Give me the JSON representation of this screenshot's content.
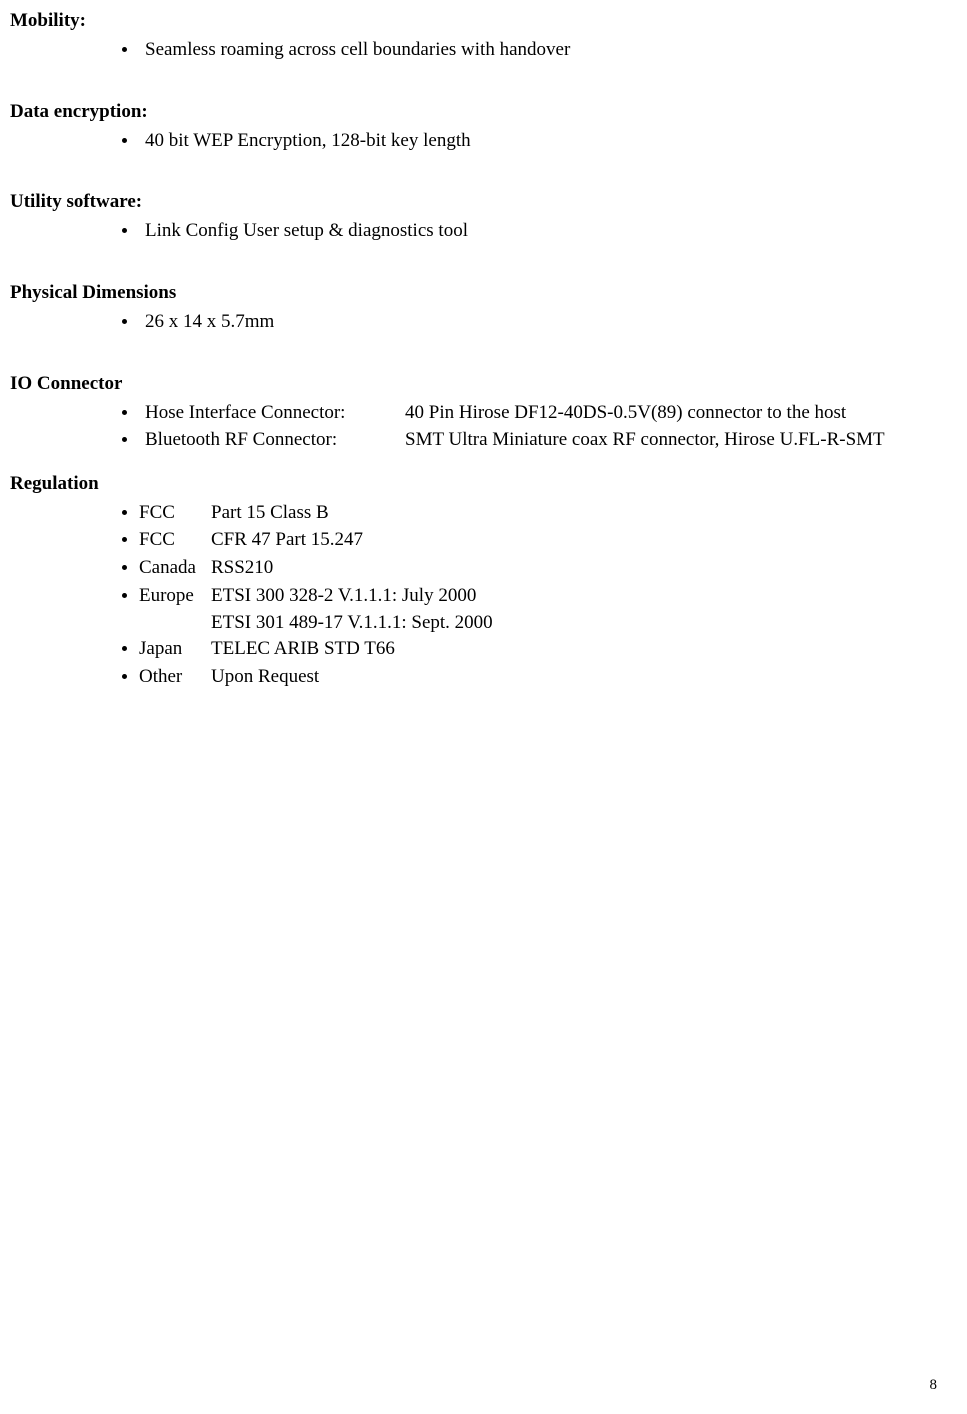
{
  "sections": {
    "mobility": {
      "header": "Mobility:",
      "item0": "Seamless roaming across cell boundaries with handover"
    },
    "encryption": {
      "header": "Data encryption:",
      "item0": "40 bit WEP Encryption, 128-bit key length"
    },
    "utility": {
      "header": "Utility software:",
      "item0": "Link Config User setup & diagnostics tool"
    },
    "physical": {
      "header": "Physical Dimensions",
      "item0": "26 x 14 x 5.7mm"
    },
    "io": {
      "header": "IO Connector",
      "item0_label": "Hose Interface Connector:",
      "item0_value": "40 Pin Hirose DF12-40DS-0.5V(89) connector to the host",
      "item1_label": "Bluetooth RF Connector:",
      "item1_value": "SMT Ultra Miniature coax RF connector, Hirose U.FL-R-SMT"
    },
    "regulation": {
      "header": "Regulation",
      "r0_label": "FCC",
      "r0_value": "Part 15 Class B",
      "r1_label": "FCC",
      "r1_value": "CFR 47 Part 15.247",
      "r2_label": "Canada",
      "r2_value": "RSS210",
      "r3_label": "Europe",
      "r3_value": "ETSI 300 328-2 V.1.1.1: July 2000",
      "r3_cont": "ETSI 301 489-17 V.1.1.1: Sept. 2000",
      "r4_label": "Japan",
      "r4_value": "TELEC ARIB STD T66",
      "r5_label": "Other",
      "r5_value": "Upon Request"
    }
  },
  "pageNumber": "8"
}
